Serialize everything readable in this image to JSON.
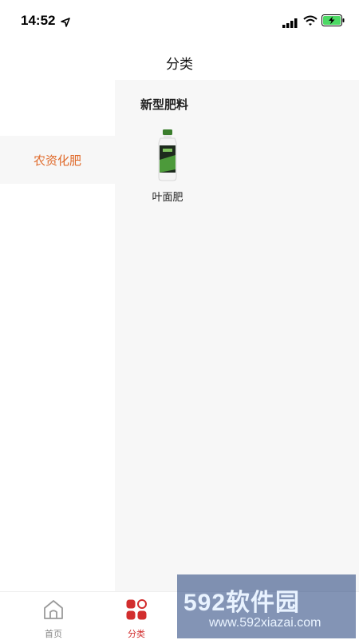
{
  "status_bar": {
    "time": "14:52"
  },
  "nav": {
    "title": "分类"
  },
  "categories": [
    {
      "label": "农资化肥",
      "selected": true
    }
  ],
  "section": {
    "title": "新型肥料",
    "products": [
      {
        "label": "叶面肥"
      }
    ]
  },
  "tabs": [
    {
      "label": "首页",
      "icon": "home-icon",
      "active": false
    },
    {
      "label": "分类",
      "icon": "category-grid-icon",
      "active": true
    }
  ],
  "watermark": {
    "brand": "592软件园",
    "url": "www.592xiazai.com"
  },
  "colors": {
    "accent_orange": "#e06a2a",
    "accent_red": "#d22d2d",
    "panel_gray": "#f7f7f7"
  }
}
